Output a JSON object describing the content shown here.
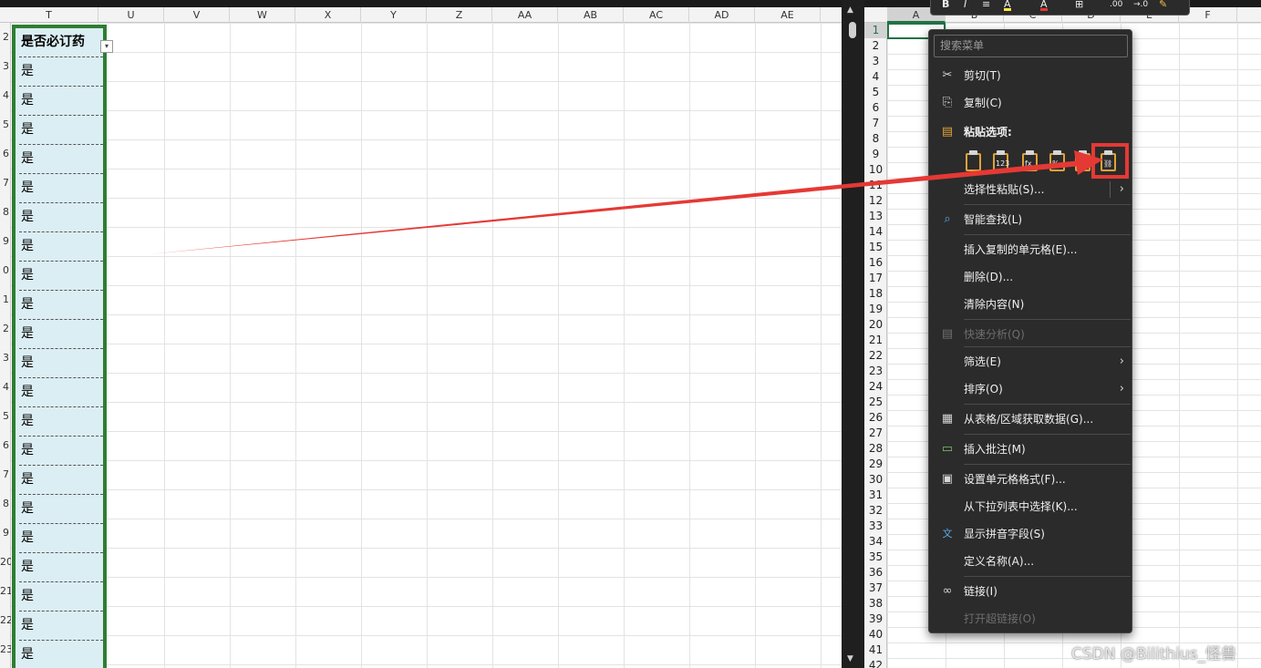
{
  "left_sheet": {
    "column_headers": [
      "T",
      "U",
      "V",
      "W",
      "X",
      "Y",
      "Z",
      "AA",
      "AB",
      "AC",
      "AD",
      "AE"
    ],
    "row_numbers": [
      "2",
      "3",
      "4",
      "5",
      "6",
      "7",
      "8",
      "9",
      "0",
      "1",
      "2",
      "3",
      "4",
      "5",
      "6",
      "7",
      "8",
      "9",
      "20",
      "21",
      "22",
      "23"
    ],
    "column_header_cell": "是否必订药",
    "filter_glyph": "▾",
    "column_values": [
      "是",
      "是",
      "是",
      "是",
      "是",
      "是",
      "是",
      "是",
      "是",
      "是",
      "是",
      "是",
      "是",
      "是",
      "是",
      "是",
      "是",
      "是",
      "是",
      "是",
      "是"
    ],
    "selection_border_color": "#2e7d32",
    "selection_fill_color": "#dbeef3"
  },
  "right_sheet": {
    "column_headers": [
      "A",
      "B",
      "C",
      "D",
      "E",
      "F"
    ],
    "row_numbers": [
      "1",
      "2",
      "3",
      "4",
      "5",
      "6",
      "7",
      "8",
      "9",
      "10",
      "11",
      "12",
      "13",
      "14",
      "15",
      "16",
      "17",
      "18",
      "19",
      "20",
      "21",
      "22",
      "23",
      "24",
      "25",
      "26",
      "27",
      "28",
      "29",
      "30",
      "31",
      "32",
      "33",
      "34",
      "35",
      "36",
      "37",
      "38",
      "39",
      "40",
      "41",
      "42"
    ],
    "active_cell_color": "#217346"
  },
  "mini_toolbar": {
    "bold": "B",
    "italic": "I",
    "align": "≡",
    "fill": "A",
    "font_color": "A",
    "borders": "⊞",
    "decimal_increase": ".00",
    "decimal_decrease": "→.0",
    "format_painter": "✎"
  },
  "context_menu": {
    "search_placeholder": "搜索菜单",
    "items": [
      {
        "label": "剪切(T)",
        "icon": "scissors-icon",
        "glyph": "✂"
      },
      {
        "label": "复制(C)",
        "icon": "copy-icon",
        "glyph": "⎘"
      },
      {
        "label": "粘贴选项:",
        "icon": "paste-icon",
        "glyph": "📋"
      },
      {
        "label": "选择性粘贴(S)...",
        "submenu": "›"
      },
      {
        "label": "智能查找(L)",
        "icon": "smart-lookup-icon",
        "glyph": "⌕"
      },
      {
        "label": "插入复制的单元格(E)..."
      },
      {
        "label": "删除(D)..."
      },
      {
        "label": "清除内容(N)"
      },
      {
        "label": "快速分析(Q)",
        "icon": "quick-analysis-icon",
        "glyph": "▤"
      },
      {
        "label": "筛选(E)",
        "submenu": "›"
      },
      {
        "label": "排序(O)",
        "submenu": "›"
      },
      {
        "label": "从表格/区域获取数据(G)...",
        "icon": "table-icon",
        "glyph": "▦"
      },
      {
        "label": "插入批注(M)",
        "icon": "comment-icon",
        "glyph": "▭"
      },
      {
        "label": "设置单元格格式(F)...",
        "icon": "format-cells-icon",
        "glyph": "▣"
      },
      {
        "label": "从下拉列表中选择(K)..."
      },
      {
        "label": "显示拼音字段(S)",
        "icon": "phonetic-icon",
        "glyph": "文"
      },
      {
        "label": "定义名称(A)..."
      },
      {
        "label": "链接(I)",
        "icon": "link-icon",
        "glyph": "∞"
      },
      {
        "label": "打开超链接(O)"
      }
    ],
    "paste_option_marks": [
      "",
      "123",
      "fx",
      "%",
      "⇄",
      "⛓"
    ],
    "highlight_color": "#e53935"
  },
  "watermark": "CSDN @Bilithius_怪兽"
}
